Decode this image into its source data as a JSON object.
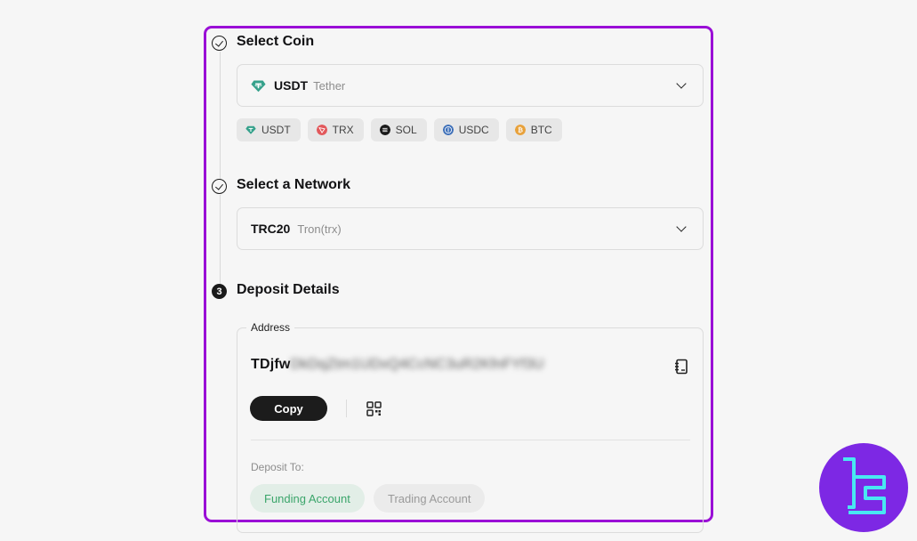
{
  "steps": {
    "coin": {
      "title": "Select Coin",
      "selected_symbol": "USDT",
      "selected_name": "Tether",
      "quick_coins": [
        "USDT",
        "TRX",
        "SOL",
        "USDC",
        "BTC"
      ]
    },
    "network": {
      "title": "Select a Network",
      "selected_symbol": "TRC20",
      "selected_name": "Tron(trx)"
    },
    "deposit": {
      "number": "3",
      "title": "Deposit Details",
      "address_legend": "Address",
      "address_prefix": "TDjfw",
      "address_hidden": "DkDqZtm1UDxQ4CcNC3uR2KfnFYf3U",
      "copy_label": "Copy",
      "deposit_to_label": "Deposit To:",
      "accounts": [
        "Funding Account",
        "Trading Account"
      ],
      "selected_account": "Funding Account"
    }
  },
  "colors": {
    "highlight_border": "#9a0fd6",
    "active_account_text": "#3ba56b",
    "logo_bg": "#7d28e4",
    "logo_fg": "#48e8f2"
  },
  "icons": {
    "usdt": "tether-icon",
    "trx": "tron-icon",
    "sol": "solana-icon",
    "usdc": "usdc-icon",
    "btc": "bitcoin-icon",
    "address_book": "address-book-icon",
    "qr": "qr-code-icon"
  }
}
